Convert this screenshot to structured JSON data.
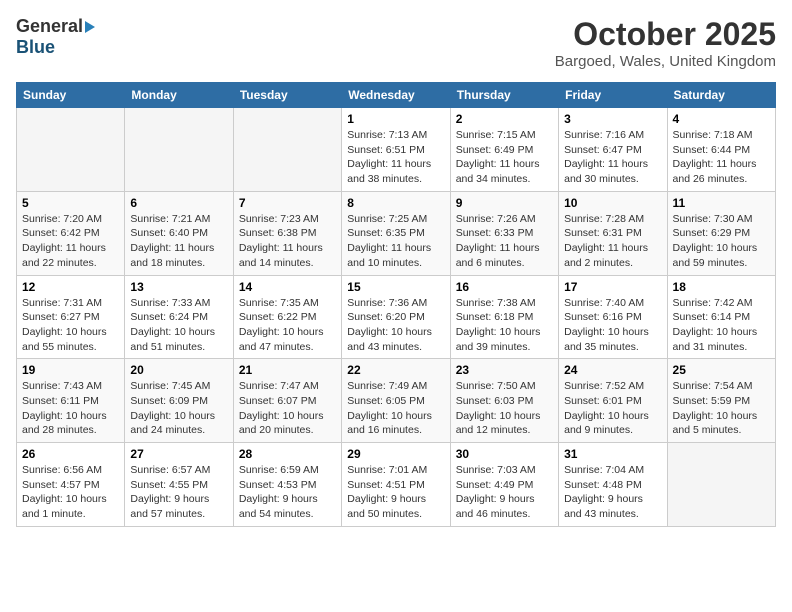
{
  "logo": {
    "general": "General",
    "blue": "Blue"
  },
  "title": "October 2025",
  "location": "Bargoed, Wales, United Kingdom",
  "headers": [
    "Sunday",
    "Monday",
    "Tuesday",
    "Wednesday",
    "Thursday",
    "Friday",
    "Saturday"
  ],
  "weeks": [
    {
      "days": [
        {
          "num": "",
          "info": "",
          "empty": true
        },
        {
          "num": "",
          "info": "",
          "empty": true
        },
        {
          "num": "",
          "info": "",
          "empty": true
        },
        {
          "num": "1",
          "info": "Sunrise: 7:13 AM\nSunset: 6:51 PM\nDaylight: 11 hours\nand 38 minutes.",
          "empty": false
        },
        {
          "num": "2",
          "info": "Sunrise: 7:15 AM\nSunset: 6:49 PM\nDaylight: 11 hours\nand 34 minutes.",
          "empty": false
        },
        {
          "num": "3",
          "info": "Sunrise: 7:16 AM\nSunset: 6:47 PM\nDaylight: 11 hours\nand 30 minutes.",
          "empty": false
        },
        {
          "num": "4",
          "info": "Sunrise: 7:18 AM\nSunset: 6:44 PM\nDaylight: 11 hours\nand 26 minutes.",
          "empty": false
        }
      ]
    },
    {
      "days": [
        {
          "num": "5",
          "info": "Sunrise: 7:20 AM\nSunset: 6:42 PM\nDaylight: 11 hours\nand 22 minutes.",
          "empty": false
        },
        {
          "num": "6",
          "info": "Sunrise: 7:21 AM\nSunset: 6:40 PM\nDaylight: 11 hours\nand 18 minutes.",
          "empty": false
        },
        {
          "num": "7",
          "info": "Sunrise: 7:23 AM\nSunset: 6:38 PM\nDaylight: 11 hours\nand 14 minutes.",
          "empty": false
        },
        {
          "num": "8",
          "info": "Sunrise: 7:25 AM\nSunset: 6:35 PM\nDaylight: 11 hours\nand 10 minutes.",
          "empty": false
        },
        {
          "num": "9",
          "info": "Sunrise: 7:26 AM\nSunset: 6:33 PM\nDaylight: 11 hours\nand 6 minutes.",
          "empty": false
        },
        {
          "num": "10",
          "info": "Sunrise: 7:28 AM\nSunset: 6:31 PM\nDaylight: 11 hours\nand 2 minutes.",
          "empty": false
        },
        {
          "num": "11",
          "info": "Sunrise: 7:30 AM\nSunset: 6:29 PM\nDaylight: 10 hours\nand 59 minutes.",
          "empty": false
        }
      ]
    },
    {
      "days": [
        {
          "num": "12",
          "info": "Sunrise: 7:31 AM\nSunset: 6:27 PM\nDaylight: 10 hours\nand 55 minutes.",
          "empty": false
        },
        {
          "num": "13",
          "info": "Sunrise: 7:33 AM\nSunset: 6:24 PM\nDaylight: 10 hours\nand 51 minutes.",
          "empty": false
        },
        {
          "num": "14",
          "info": "Sunrise: 7:35 AM\nSunset: 6:22 PM\nDaylight: 10 hours\nand 47 minutes.",
          "empty": false
        },
        {
          "num": "15",
          "info": "Sunrise: 7:36 AM\nSunset: 6:20 PM\nDaylight: 10 hours\nand 43 minutes.",
          "empty": false
        },
        {
          "num": "16",
          "info": "Sunrise: 7:38 AM\nSunset: 6:18 PM\nDaylight: 10 hours\nand 39 minutes.",
          "empty": false
        },
        {
          "num": "17",
          "info": "Sunrise: 7:40 AM\nSunset: 6:16 PM\nDaylight: 10 hours\nand 35 minutes.",
          "empty": false
        },
        {
          "num": "18",
          "info": "Sunrise: 7:42 AM\nSunset: 6:14 PM\nDaylight: 10 hours\nand 31 minutes.",
          "empty": false
        }
      ]
    },
    {
      "days": [
        {
          "num": "19",
          "info": "Sunrise: 7:43 AM\nSunset: 6:11 PM\nDaylight: 10 hours\nand 28 minutes.",
          "empty": false
        },
        {
          "num": "20",
          "info": "Sunrise: 7:45 AM\nSunset: 6:09 PM\nDaylight: 10 hours\nand 24 minutes.",
          "empty": false
        },
        {
          "num": "21",
          "info": "Sunrise: 7:47 AM\nSunset: 6:07 PM\nDaylight: 10 hours\nand 20 minutes.",
          "empty": false
        },
        {
          "num": "22",
          "info": "Sunrise: 7:49 AM\nSunset: 6:05 PM\nDaylight: 10 hours\nand 16 minutes.",
          "empty": false
        },
        {
          "num": "23",
          "info": "Sunrise: 7:50 AM\nSunset: 6:03 PM\nDaylight: 10 hours\nand 12 minutes.",
          "empty": false
        },
        {
          "num": "24",
          "info": "Sunrise: 7:52 AM\nSunset: 6:01 PM\nDaylight: 10 hours\nand 9 minutes.",
          "empty": false
        },
        {
          "num": "25",
          "info": "Sunrise: 7:54 AM\nSunset: 5:59 PM\nDaylight: 10 hours\nand 5 minutes.",
          "empty": false
        }
      ]
    },
    {
      "days": [
        {
          "num": "26",
          "info": "Sunrise: 6:56 AM\nSunset: 4:57 PM\nDaylight: 10 hours\nand 1 minute.",
          "empty": false
        },
        {
          "num": "27",
          "info": "Sunrise: 6:57 AM\nSunset: 4:55 PM\nDaylight: 9 hours\nand 57 minutes.",
          "empty": false
        },
        {
          "num": "28",
          "info": "Sunrise: 6:59 AM\nSunset: 4:53 PM\nDaylight: 9 hours\nand 54 minutes.",
          "empty": false
        },
        {
          "num": "29",
          "info": "Sunrise: 7:01 AM\nSunset: 4:51 PM\nDaylight: 9 hours\nand 50 minutes.",
          "empty": false
        },
        {
          "num": "30",
          "info": "Sunrise: 7:03 AM\nSunset: 4:49 PM\nDaylight: 9 hours\nand 46 minutes.",
          "empty": false
        },
        {
          "num": "31",
          "info": "Sunrise: 7:04 AM\nSunset: 4:48 PM\nDaylight: 9 hours\nand 43 minutes.",
          "empty": false
        },
        {
          "num": "",
          "info": "",
          "empty": true
        }
      ]
    }
  ]
}
